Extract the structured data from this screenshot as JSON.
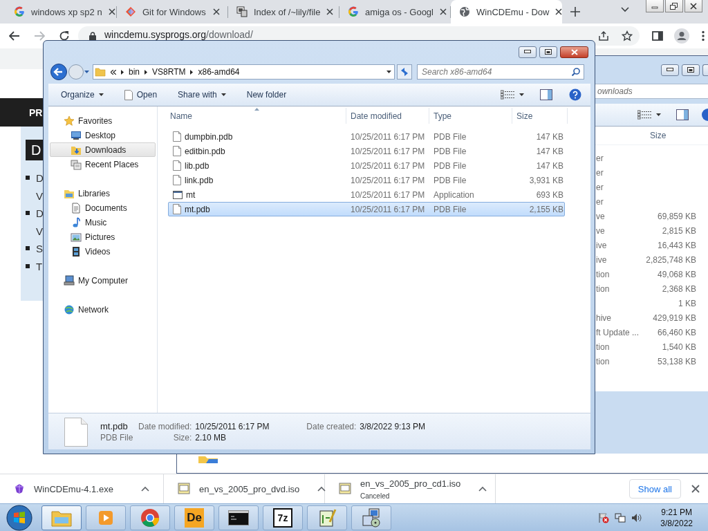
{
  "browser": {
    "tabs": [
      {
        "title": "windows xp sp2 n",
        "kind": "letter",
        "selected": false
      },
      {
        "title": "Git for Windows",
        "kind": "diamond",
        "selected": false
      },
      {
        "title": "Index of /~lily/file",
        "kind": "server",
        "selected": false
      },
      {
        "title": "amiga os - Googl",
        "kind": "letter",
        "selected": false
      },
      {
        "title": "WinCDEmu - Dow",
        "kind": "globe",
        "selected": true
      }
    ],
    "forward_disabled": true,
    "url_host": "wincdemu.sysprogs.org",
    "url_path": "/download/"
  },
  "page": {
    "nav_text": "PR",
    "heading": "D",
    "bullets": [
      {
        "lines": [
          "D",
          "V"
        ]
      },
      {
        "lines": [
          "D",
          "V"
        ]
      },
      {
        "lines": [
          "S"
        ]
      },
      {
        "lines": [
          "T"
        ]
      }
    ]
  },
  "background_window": {
    "search": "ownloads",
    "size_header": "Size",
    "rows": [
      {
        "type": "er"
      },
      {
        "type": "er"
      },
      {
        "type": "er"
      },
      {
        "type": "er"
      },
      {
        "type": "ve",
        "size": "69,859 KB"
      },
      {
        "type": "ve",
        "size": "2,815 KB"
      },
      {
        "type": "ive",
        "size": "16,443 KB"
      },
      {
        "type": "ive",
        "size": "2,825,748 KB"
      },
      {
        "type": "tion",
        "size": "49,068 KB"
      },
      {
        "type": "tion",
        "size": "2,368 KB"
      },
      {
        "size": "1 KB"
      },
      {
        "type": "hive",
        "size": "429,919 KB"
      },
      {
        "type": "ft Update ...",
        "size": "66,460 KB"
      },
      {
        "type": "tion",
        "size": "1,540 KB"
      },
      {
        "type": "tion",
        "size": "53,138 KB"
      }
    ]
  },
  "explorer": {
    "forward_disabled": true,
    "crumbs": [
      "bin",
      "VS8RTM",
      "x86-amd64"
    ],
    "search_placeholder": "Search x86-amd64",
    "commands": [
      {
        "label": "Organize",
        "kind": "menu"
      },
      {
        "label": "Open",
        "kind": "open"
      },
      {
        "label": "Share with",
        "kind": "menu"
      },
      {
        "label": "New folder",
        "kind": "plain"
      }
    ],
    "nav": [
      {
        "label": "Favorites",
        "kind": "star",
        "selected": false,
        "children": [
          {
            "label": "Desktop",
            "kind": "desktop",
            "selected": false
          },
          {
            "label": "Downloads",
            "kind": "downloads",
            "selected": true
          },
          {
            "label": "Recent Places",
            "kind": "recent",
            "selected": false
          }
        ]
      },
      {
        "label": "Libraries",
        "kind": "library",
        "selected": false,
        "children": [
          {
            "label": "Documents",
            "kind": "documents",
            "selected": false
          },
          {
            "label": "Music",
            "kind": "music",
            "selected": false
          },
          {
            "label": "Pictures",
            "kind": "pictures",
            "selected": false
          },
          {
            "label": "Videos",
            "kind": "videos",
            "selected": false
          }
        ]
      },
      {
        "label": "My Computer",
        "kind": "computer",
        "selected": false
      },
      {
        "label": "Network",
        "kind": "network",
        "selected": false
      }
    ],
    "columns": [
      {
        "label": "Name",
        "sorted": true
      },
      {
        "label": "Date modified",
        "sorted": false
      },
      {
        "label": "Type",
        "sorted": false
      },
      {
        "label": "Size",
        "sorted": false
      }
    ],
    "files": [
      {
        "name": "dumpbin.pdb",
        "date": "10/25/2011 6:17 PM",
        "type": "PDB File",
        "size": "147 KB",
        "kind": "document",
        "selected": false
      },
      {
        "name": "editbin.pdb",
        "date": "10/25/2011 6:17 PM",
        "type": "PDB File",
        "size": "147 KB",
        "kind": "document",
        "selected": false
      },
      {
        "name": "lib.pdb",
        "date": "10/25/2011 6:17 PM",
        "type": "PDB File",
        "size": "147 KB",
        "kind": "document",
        "selected": false
      },
      {
        "name": "link.pdb",
        "date": "10/25/2011 6:17 PM",
        "type": "PDB File",
        "size": "3,931 KB",
        "kind": "document",
        "selected": false
      },
      {
        "name": "mt",
        "date": "10/25/2011 6:17 PM",
        "type": "Application",
        "size": "693 KB",
        "kind": "application",
        "selected": false
      },
      {
        "name": "mt.pdb",
        "date": "10/25/2011 6:17 PM",
        "type": "PDB File",
        "size": "2,155 KB",
        "kind": "document",
        "selected": true
      }
    ],
    "details": {
      "name": "mt.pdb",
      "type": "PDB File",
      "fields": [
        {
          "label": "Date modified:",
          "value": "10/25/2011 6:17 PM"
        },
        {
          "label": "Date created:",
          "value": "3/8/2022 9:13 PM"
        },
        {
          "label": "Size:",
          "value": "2.10 MB"
        }
      ]
    }
  },
  "downloads": {
    "items": [
      {
        "name": "WinCDEmu-4.1.exe",
        "kind": "installer"
      },
      {
        "name": "en_vs_2005_pro_dvd.iso",
        "kind": "disc"
      },
      {
        "name": "en_vs_2005_pro_cd1.iso",
        "kind": "disc",
        "status": "Canceled"
      }
    ],
    "show_all": "Show all"
  },
  "taskbar": {
    "apps": [
      {
        "kind": "folder",
        "selected": true
      },
      {
        "kind": "media",
        "selected": false
      },
      {
        "kind": "browser",
        "selected": false
      },
      {
        "kind": "logo",
        "label": "De",
        "selected": false
      },
      {
        "kind": "console",
        "selected": false
      },
      {
        "kind": "logo",
        "label": "7z",
        "selected": false
      },
      {
        "kind": "editor",
        "selected": false
      },
      {
        "kind": "setup",
        "selected": false
      }
    ],
    "time": "9:21 PM",
    "date": "3/8/2022"
  }
}
